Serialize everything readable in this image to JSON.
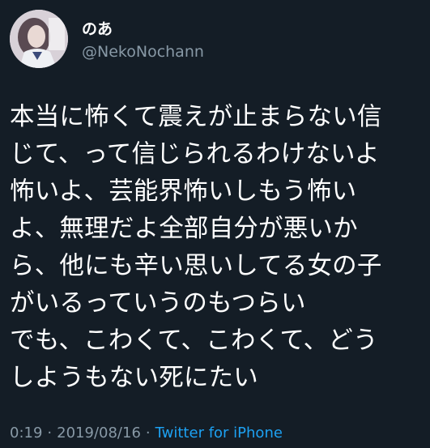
{
  "tweet": {
    "author": {
      "display_name": "のあ",
      "handle": "@NekoNochann",
      "avatar_icon": "profile-photo"
    },
    "text_lines": [
      "本当に怖くて震えが止まらない信",
      "じて、って信じられるわけないよ",
      "怖いよ、芸能界怖いしもう怖い",
      "よ、無理だよ全部自分が悪いか",
      "ら、他にも辛い思いしてる女の子",
      "がいるっていうのもつらい",
      "でも、こわくて、こわくて、どう",
      "しようもない死にたい"
    ],
    "meta": {
      "time": "0:19",
      "date": "2019/08/16",
      "separator": "·",
      "source": "Twitter for iPhone"
    }
  },
  "colors": {
    "background": "#141d26",
    "primary_text": "#ffffff",
    "secondary_text": "#8899a6",
    "link": "#1da1f2"
  }
}
